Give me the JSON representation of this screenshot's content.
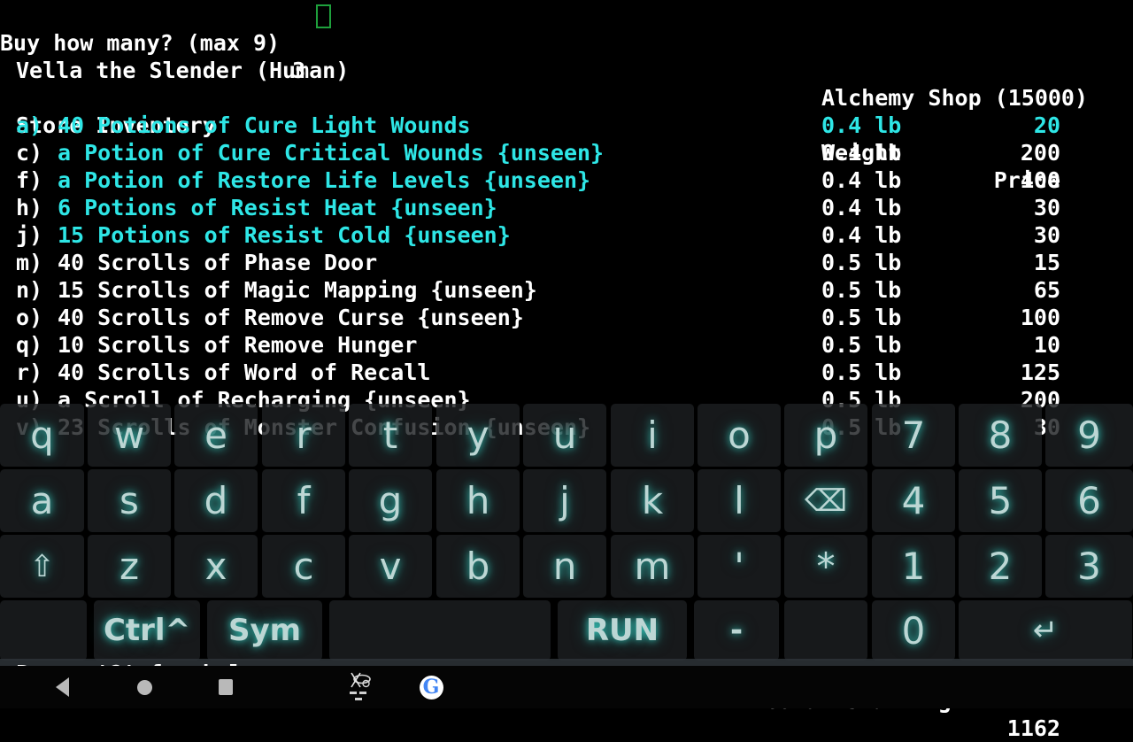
{
  "screen": {
    "background": "#000000",
    "text_color": "#ffffff",
    "highlight_color": "#2ee6e6",
    "cursor_color": "#1ea03c"
  },
  "prompt": {
    "text": "Buy how many? (max 9) ",
    "value": "3"
  },
  "character": {
    "line": "Vella the Slender (Human)"
  },
  "shop": {
    "title": "Alchemy Shop (15000)"
  },
  "inventory": {
    "heading": "Store Inventory",
    "columns": {
      "weight": "Weight",
      "price": "Price"
    },
    "items": [
      {
        "tag": "a)",
        "desc": "40 Potions of Cure Light Wounds",
        "weight": "0.4 lb",
        "price": "20",
        "color": "#2ee6e6",
        "selected": true
      },
      {
        "tag": "c)",
        "desc": "a Potion of Cure Critical Wounds {unseen}",
        "weight": "0.4 lb",
        "price": "200",
        "color": "#2ee6e6",
        "selected": false
      },
      {
        "tag": "f)",
        "desc": "a Potion of Restore Life Levels {unseen}",
        "weight": "0.4 lb",
        "price": "400",
        "color": "#2ee6e6",
        "selected": false
      },
      {
        "tag": "h)",
        "desc": "6 Potions of Resist Heat {unseen}",
        "weight": "0.4 lb",
        "price": "30",
        "color": "#2ee6e6",
        "selected": false
      },
      {
        "tag": "j)",
        "desc": "15 Potions of Resist Cold {unseen}",
        "weight": "0.4 lb",
        "price": "30",
        "color": "#2ee6e6",
        "selected": false
      },
      {
        "tag": "m)",
        "desc": "40 Scrolls of Phase Door",
        "weight": "0.5 lb",
        "price": "15",
        "color": "#ffffff",
        "selected": false
      },
      {
        "tag": "n)",
        "desc": "15 Scrolls of Magic Mapping {unseen}",
        "weight": "0.5 lb",
        "price": "65",
        "color": "#ffffff",
        "selected": false
      },
      {
        "tag": "o)",
        "desc": "40 Scrolls of Remove Curse {unseen}",
        "weight": "0.5 lb",
        "price": "100",
        "color": "#ffffff",
        "selected": false
      },
      {
        "tag": "q)",
        "desc": "10 Scrolls of Remove Hunger",
        "weight": "0.5 lb",
        "price": "10",
        "color": "#ffffff",
        "selected": false
      },
      {
        "tag": "r)",
        "desc": "40 Scrolls of Word of Recall",
        "weight": "0.5 lb",
        "price": "125",
        "color": "#ffffff",
        "selected": false
      },
      {
        "tag": "u)",
        "desc": "a Scroll of Recharging {unseen}",
        "weight": "0.5 lb",
        "price": "200",
        "color": "#ffffff",
        "selected": false
      },
      {
        "tag": "v)",
        "desc": "23 Scrolls of Monster Confusion {unseen}",
        "weight": "0.5 lb",
        "price": "30",
        "color": "#ffffff",
        "selected": false
      }
    ]
  },
  "status": {
    "help_hint": "Press '?' for help.",
    "gold_label": "Gold Remaining:",
    "gold_value": "1162"
  },
  "keyboard": {
    "rows": [
      [
        {
          "label": "q",
          "name": "key-q"
        },
        {
          "label": "w",
          "name": "key-w"
        },
        {
          "label": "e",
          "name": "key-e"
        },
        {
          "label": "r",
          "name": "key-r"
        },
        {
          "label": "t",
          "name": "key-t"
        },
        {
          "label": "y",
          "name": "key-y"
        },
        {
          "label": "u",
          "name": "key-u"
        },
        {
          "label": "i",
          "name": "key-i"
        },
        {
          "label": "o",
          "name": "key-o"
        },
        {
          "label": "p",
          "name": "key-p"
        },
        {
          "label": "7",
          "name": "key-7"
        },
        {
          "label": "8",
          "name": "key-8"
        },
        {
          "label": "9",
          "name": "key-9"
        }
      ],
      [
        {
          "label": "a",
          "name": "key-a"
        },
        {
          "label": "s",
          "name": "key-s"
        },
        {
          "label": "d",
          "name": "key-d"
        },
        {
          "label": "f",
          "name": "key-f"
        },
        {
          "label": "g",
          "name": "key-g"
        },
        {
          "label": "h",
          "name": "key-h"
        },
        {
          "label": "j",
          "name": "key-j"
        },
        {
          "label": "k",
          "name": "key-k"
        },
        {
          "label": "l",
          "name": "key-l"
        },
        {
          "label": "⌫",
          "name": "backspace-icon"
        },
        {
          "label": "4",
          "name": "key-4"
        },
        {
          "label": "5",
          "name": "key-5"
        },
        {
          "label": "6",
          "name": "key-6"
        }
      ],
      [
        {
          "label": "⇧",
          "name": "shift-icon"
        },
        {
          "label": "z",
          "name": "key-z"
        },
        {
          "label": "x",
          "name": "key-x"
        },
        {
          "label": "c",
          "name": "key-c"
        },
        {
          "label": "v",
          "name": "key-v"
        },
        {
          "label": "b",
          "name": "key-b"
        },
        {
          "label": "n",
          "name": "key-n"
        },
        {
          "label": "m",
          "name": "key-m"
        },
        {
          "label": "'",
          "name": "key-apostrophe"
        },
        {
          "label": "*",
          "name": "key-asterisk"
        },
        {
          "label": "1",
          "name": "key-1"
        },
        {
          "label": "2",
          "name": "key-2"
        },
        {
          "label": "3",
          "name": "key-3"
        }
      ]
    ],
    "bottom_row": [
      {
        "label": "",
        "name": "key-blank-left"
      },
      {
        "label": "Ctrl^",
        "name": "key-ctrl"
      },
      {
        "label": "Sym",
        "name": "key-sym"
      },
      {
        "label": "",
        "name": "key-space"
      },
      {
        "label": "RUN",
        "name": "key-run"
      },
      {
        "label": "-",
        "name": "key-minus"
      },
      {
        "label": "",
        "name": "key-blank-right"
      },
      {
        "label": "0",
        "name": "key-0"
      },
      {
        "label": "↵",
        "name": "enter-icon"
      }
    ]
  },
  "navbar": {
    "back": "back-icon",
    "home": "home-icon",
    "recents": "recents-icon",
    "ime": "ime-switch-icon",
    "google": "G"
  }
}
